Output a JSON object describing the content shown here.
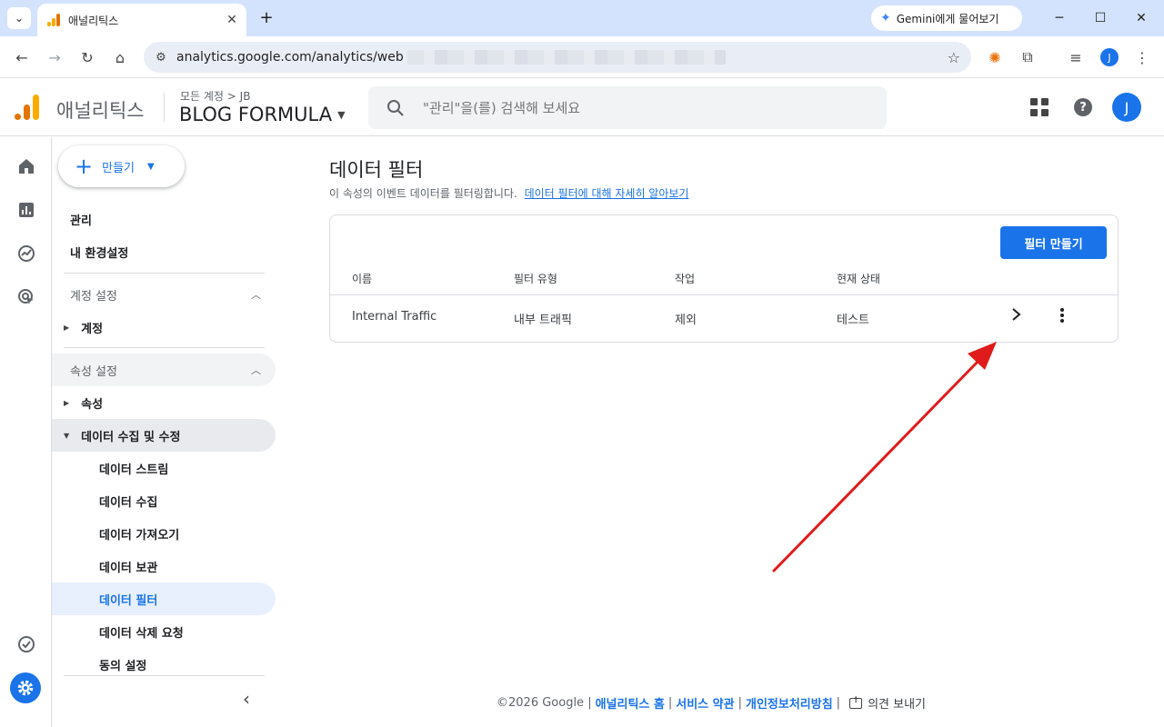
{
  "browser": {
    "tab_title": "애널리틱스",
    "gemini_label": "Gemini에게 물어보기",
    "url": "analytics.google.com/analytics/web",
    "profile_initial": "J"
  },
  "header": {
    "product": "애널리틱스",
    "breadcrumb": "모든 계정 > JB",
    "account": "BLOG FORMULA",
    "search_placeholder": "\"관리\"을(를) 검색해 보세요",
    "avatar_initial": "J"
  },
  "nav": {
    "create_label": "만들기",
    "admin": "관리",
    "preferences": "내 환경설정",
    "account_settings": "계정 설정",
    "account": "계정",
    "property_settings": "속성 설정",
    "property": "속성",
    "data_collection": "데이터 수집 및 수정",
    "sub_items": [
      "데이터 스트림",
      "데이터 수집",
      "데이터 가져오기",
      "데이터 보관",
      "데이터 필터",
      "데이터 삭제 요청",
      "동의 설정"
    ]
  },
  "main": {
    "title": "데이터 필터",
    "description": "이 속성의 이벤트 데이터를 필터링합니다.",
    "learn_more": "데이터 필터에 대해 자세히 알아보기",
    "create_button": "필터 만들기",
    "columns": [
      "이름",
      "필터 유형",
      "작업",
      "현재 상태"
    ],
    "rows": [
      {
        "name": "Internal Traffic",
        "type": "내부 트래픽",
        "action": "제외",
        "status": "테스트"
      }
    ]
  },
  "footer": {
    "copyright": "©2026 Google |",
    "home": "애널리틱스 홈",
    "terms": "서비스 약관",
    "privacy": "개인정보처리방침",
    "feedback": "의견 보내기"
  },
  "colors": {
    "accent": "#1a73e8",
    "annotation_arrow": "#e01b1b"
  }
}
